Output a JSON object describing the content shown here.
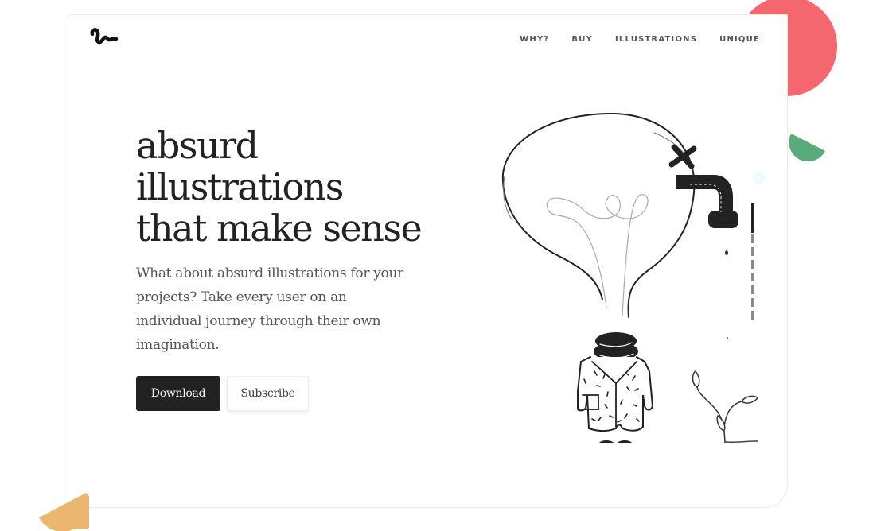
{
  "colors": {
    "accent_red": "#f4676f",
    "accent_green": "#5aab7c",
    "accent_orange": "#ebb76e",
    "accent_cyan": "#ecfcfa",
    "ink": "#222222"
  },
  "logo": {
    "icon": "squiggle-logo-icon"
  },
  "nav": {
    "items": [
      {
        "label": "WHY?"
      },
      {
        "label": "BUY"
      },
      {
        "label": "ILLUSTRATIONS"
      },
      {
        "label": "UNIQUE"
      }
    ]
  },
  "hero": {
    "title_lines": [
      "absurd",
      "illustrations",
      "that make sense"
    ],
    "description": "What about absurd illustrations for your projects? Take every user on an individual journey through their own imagination.",
    "primary_button": "Download",
    "secondary_button": "Subscribe"
  },
  "illustration": {
    "subject": "lightbulb-head-figure-with-faucet-and-sprout"
  },
  "scroll_indicator": {
    "progress": 0.25
  }
}
